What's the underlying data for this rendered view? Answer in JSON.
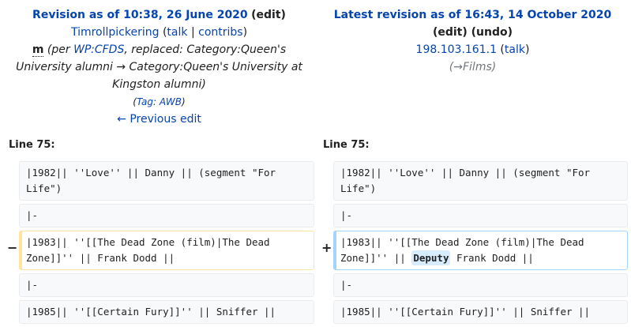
{
  "left_header": {
    "title": "Revision as of 10:38, 26 June 2020",
    "edit": "edit",
    "user": "Timrollpickering",
    "talk": "talk",
    "contribs": "contribs",
    "minor": "m",
    "summary_pre": "(per ",
    "summary_link": "WP:CFDS",
    "summary_post": ", replaced: Category:Queen's University alumni → Category:Queen's University at Kingston alumni)",
    "tag_label": "Tag: ",
    "tag_link": "AWB",
    "prev_edit": "← Previous edit"
  },
  "right_header": {
    "title": "Latest revision as of 16:43, 14 October 2020",
    "edit": "edit",
    "undo": "undo",
    "user": "198.103.161.1",
    "talk": "talk",
    "summary_arrow": "→",
    "summary_section": "Films"
  },
  "line_label_left": "Line 75:",
  "line_label_right": "Line 75:",
  "markers": {
    "removed": "−",
    "added": "+"
  },
  "rows": {
    "r1": "|1982|| ''Love'' || Danny || (segment \"For Life\")",
    "r2": "|-",
    "r3_left": "|1983|| ''[[The Dead Zone (film)|The Dead Zone]]'' || Frank Dodd ||",
    "r3_right_pre": "|1983|| ''[[The Dead Zone (film)|The Dead Zone]]'' || ",
    "r3_right_ins": "Deputy",
    "r3_right_post": " Frank Dodd ||",
    "r4": "|-",
    "r5": "|1985|| ''[[Certain Fury]]'' || Sniffer ||"
  }
}
